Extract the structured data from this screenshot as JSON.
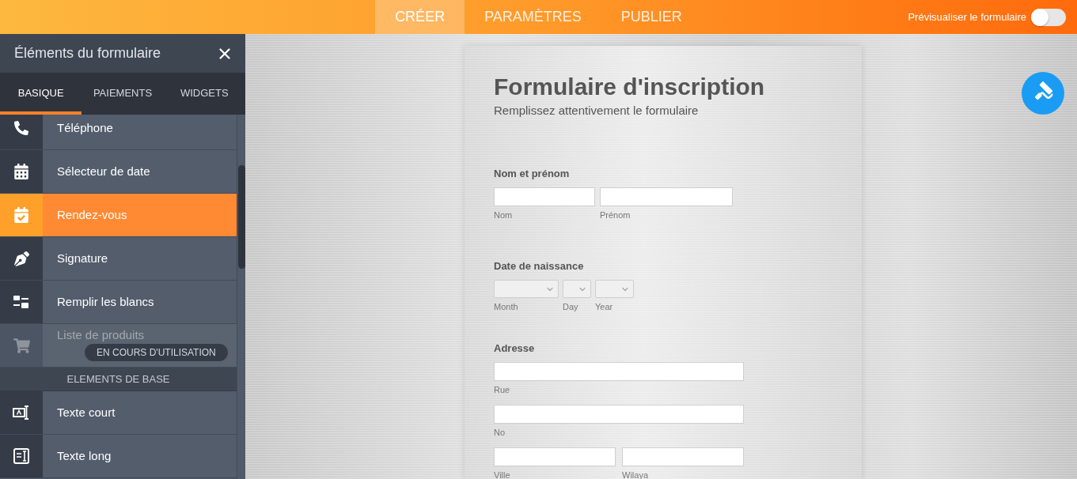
{
  "top_bar": {
    "tabs": [
      {
        "label": "CRÉER",
        "selected": true
      },
      {
        "label": "PARAMÈTRES",
        "selected": false
      },
      {
        "label": "PUBLIER",
        "selected": false
      }
    ],
    "preview_toggle": {
      "label": "Prévisualiser le formulaire",
      "on": false
    }
  },
  "sidebar": {
    "title": "Éléments du formulaire",
    "tabs": [
      {
        "label": "BASIQUE",
        "selected": true
      },
      {
        "label": "PAIEMENTS",
        "selected": false
      },
      {
        "label": "WIDGETS",
        "selected": false
      }
    ],
    "items": [
      {
        "kind": "element",
        "label": "Téléphone",
        "selected": false,
        "disabled": false
      },
      {
        "kind": "element",
        "label": "Sélecteur de date",
        "selected": false,
        "disabled": false
      },
      {
        "kind": "element",
        "label": "Rendez-vous",
        "selected": true,
        "disabled": false
      },
      {
        "kind": "element",
        "label": "Signature",
        "selected": false,
        "disabled": false
      },
      {
        "kind": "element",
        "label": "Remplir les blancs",
        "selected": false,
        "disabled": false
      },
      {
        "kind": "element",
        "label": "Liste de produits",
        "selected": false,
        "disabled": true,
        "badge": "EN COURS D'UTILISATION"
      },
      {
        "kind": "section",
        "label": "ELEMENTS DE BASE"
      },
      {
        "kind": "element",
        "label": "Texte court",
        "selected": false,
        "disabled": false
      },
      {
        "kind": "element",
        "label": "Texte long",
        "selected": false,
        "disabled": false
      }
    ]
  },
  "form": {
    "title": "Formulaire d'inscription",
    "subtitle": "Remplissez attentivement le formulaire",
    "fields": [
      {
        "label": "Nom et prénom",
        "rows": [
          [
            {
              "kind": "text",
              "sublabel": "Nom"
            },
            {
              "kind": "text",
              "sublabel": "Prénom"
            }
          ]
        ]
      },
      {
        "label": "Date de naissance",
        "rows": [
          [
            {
              "kind": "select",
              "sublabel": "Month"
            },
            {
              "kind": "select",
              "sublabel": "Day"
            },
            {
              "kind": "select",
              "sublabel": "Year"
            }
          ]
        ]
      },
      {
        "label": "Adresse",
        "rows": [
          [
            {
              "kind": "text",
              "sublabel": "Rue"
            }
          ],
          [
            {
              "kind": "text",
              "sublabel": "No"
            }
          ],
          [
            {
              "kind": "text",
              "sublabel": "Ville"
            },
            {
              "kind": "text",
              "sublabel": "Wilaya"
            }
          ]
        ]
      }
    ]
  }
}
